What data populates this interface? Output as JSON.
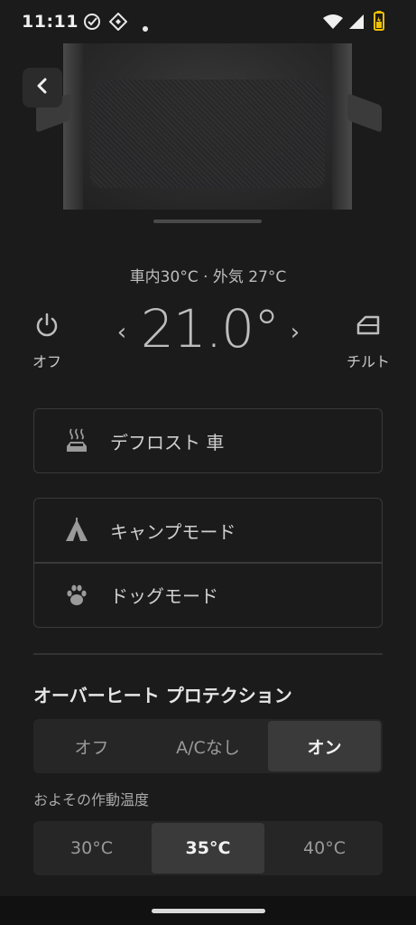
{
  "status_bar": {
    "time": "11:11"
  },
  "temperature": {
    "interior_outside": "車内30°C · 外気 27°C",
    "value": "21.0°",
    "decrease_glyph": "‹",
    "increase_glyph": "›"
  },
  "controls": {
    "power_label": "オフ",
    "tilt_label": "チルト"
  },
  "defrost": {
    "label": "デフロスト 車"
  },
  "modes": {
    "camp_label": "キャンプモード",
    "dog_label": "ドッグモード"
  },
  "overheat": {
    "title": "オーバーヒート プロテクション",
    "options": [
      "オフ",
      "A/Cなし",
      "オン"
    ],
    "selected": "オン"
  },
  "activation": {
    "label": "およその作動温度",
    "options": [
      "30°C",
      "35°C",
      "40°C"
    ],
    "selected": "35°C"
  },
  "icons": {
    "back": "chevron-left-icon",
    "power": "power-icon",
    "tilt": "tilt-icon",
    "defrost": "defrost-car-icon",
    "camp": "tent-icon",
    "dog": "paw-icon"
  }
}
